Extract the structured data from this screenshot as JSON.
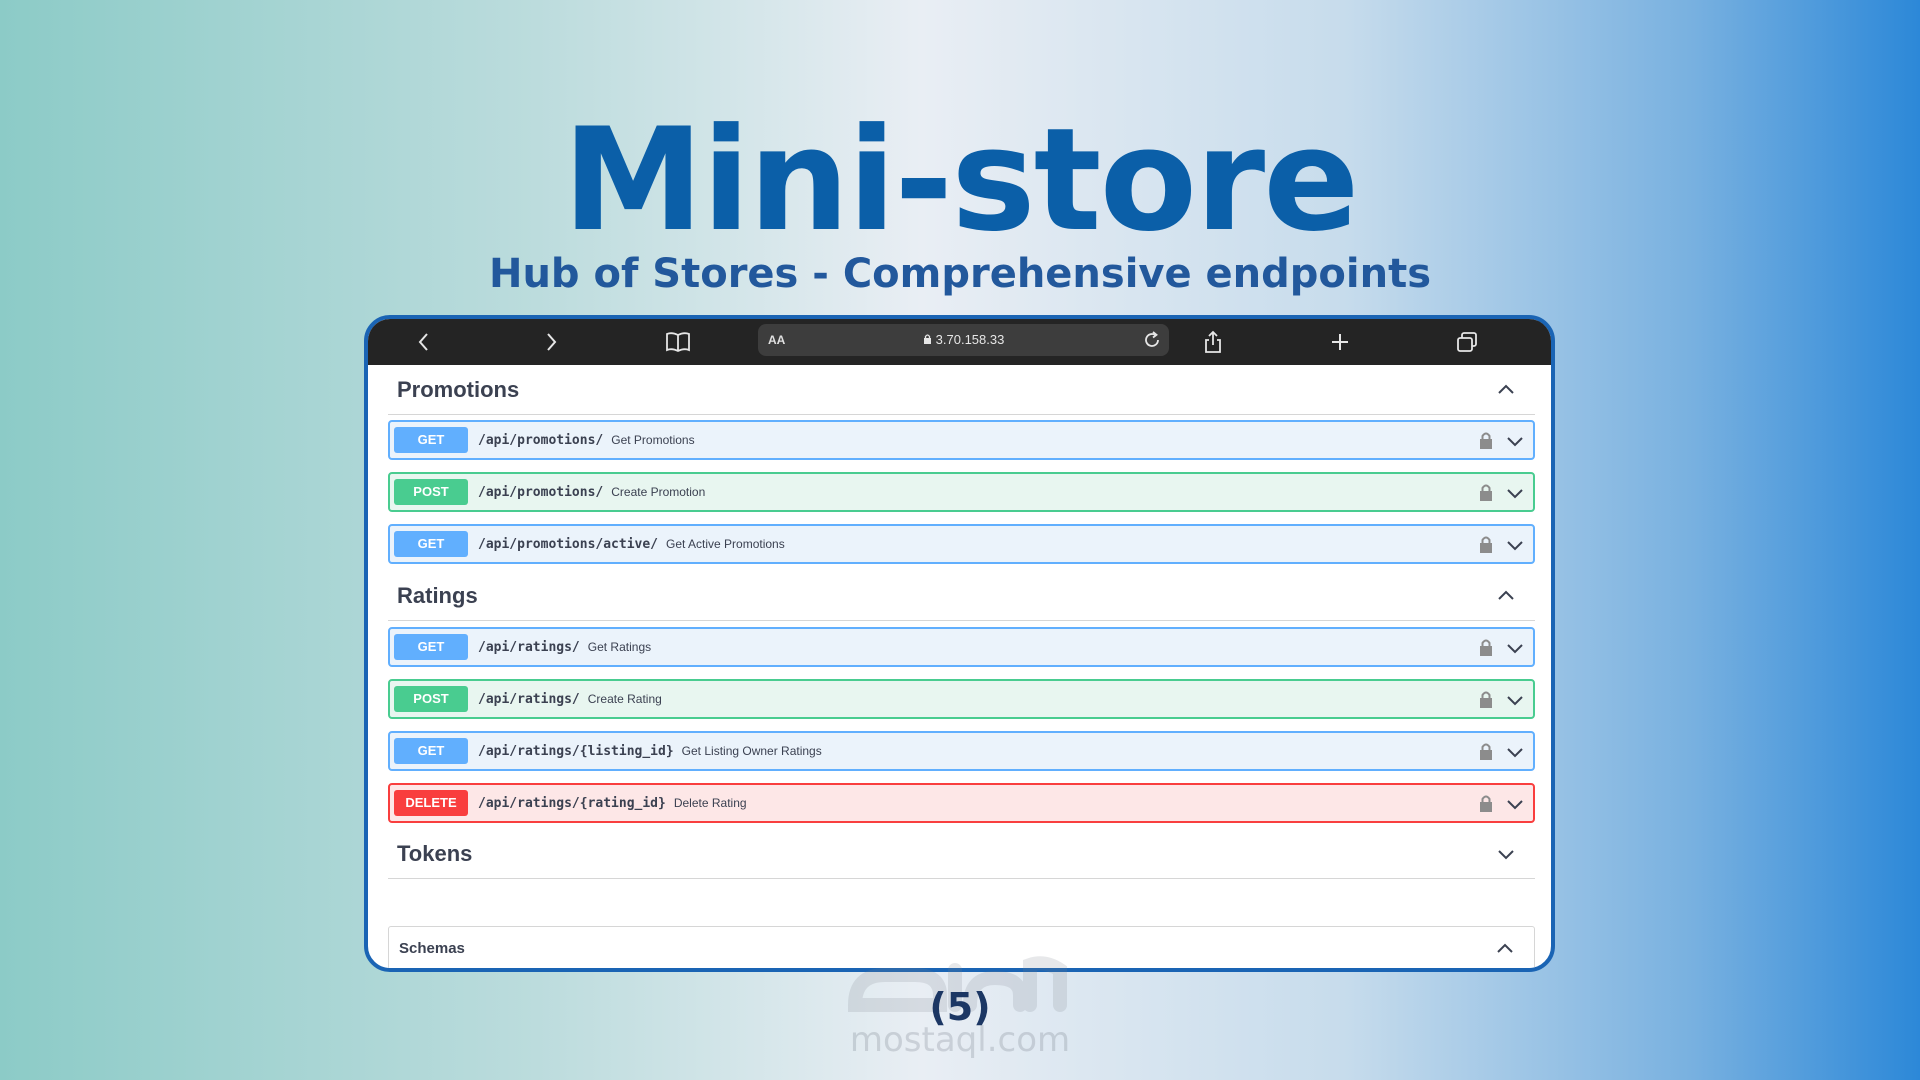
{
  "header": {
    "title": "Mini-store",
    "subtitle": "Hub of Stores - Comprehensive endpoints"
  },
  "browser": {
    "url": "3.70.158.33",
    "text_size_label": "AA",
    "icons": [
      "chevron-left-icon",
      "chevron-right-icon",
      "book-icon",
      "lock-icon",
      "reload-icon",
      "share-icon",
      "plus-icon",
      "tabs-icon"
    ]
  },
  "sections": [
    {
      "title": "Promotions",
      "expanded": true,
      "operations": [
        {
          "method": "GET",
          "path": "/api/promotions/",
          "summary": "Get Promotions"
        },
        {
          "method": "POST",
          "path": "/api/promotions/",
          "summary": "Create Promotion"
        },
        {
          "method": "GET",
          "path": "/api/promotions/active/",
          "summary": "Get Active Promotions"
        }
      ]
    },
    {
      "title": "Ratings",
      "expanded": true,
      "operations": [
        {
          "method": "GET",
          "path": "/api/ratings/",
          "summary": "Get Ratings"
        },
        {
          "method": "POST",
          "path": "/api/ratings/",
          "summary": "Create Rating"
        },
        {
          "method": "GET",
          "path": "/api/ratings/{listing_id}",
          "summary": "Get Listing Owner Ratings"
        },
        {
          "method": "DELETE",
          "path": "/api/ratings/{rating_id}",
          "summary": "Delete Rating"
        }
      ]
    },
    {
      "title": "Tokens",
      "expanded": false,
      "operations": []
    }
  ],
  "schemas": {
    "title": "Schemas"
  },
  "footer": {
    "page_number": "(5)",
    "watermark": "mostaql.com"
  },
  "colors": {
    "title": "#0b5fa8",
    "subtitle": "#22589c",
    "get": "#61affe",
    "post": "#49cc90",
    "delete": "#f93e3e",
    "frame": "#1a64b4"
  }
}
